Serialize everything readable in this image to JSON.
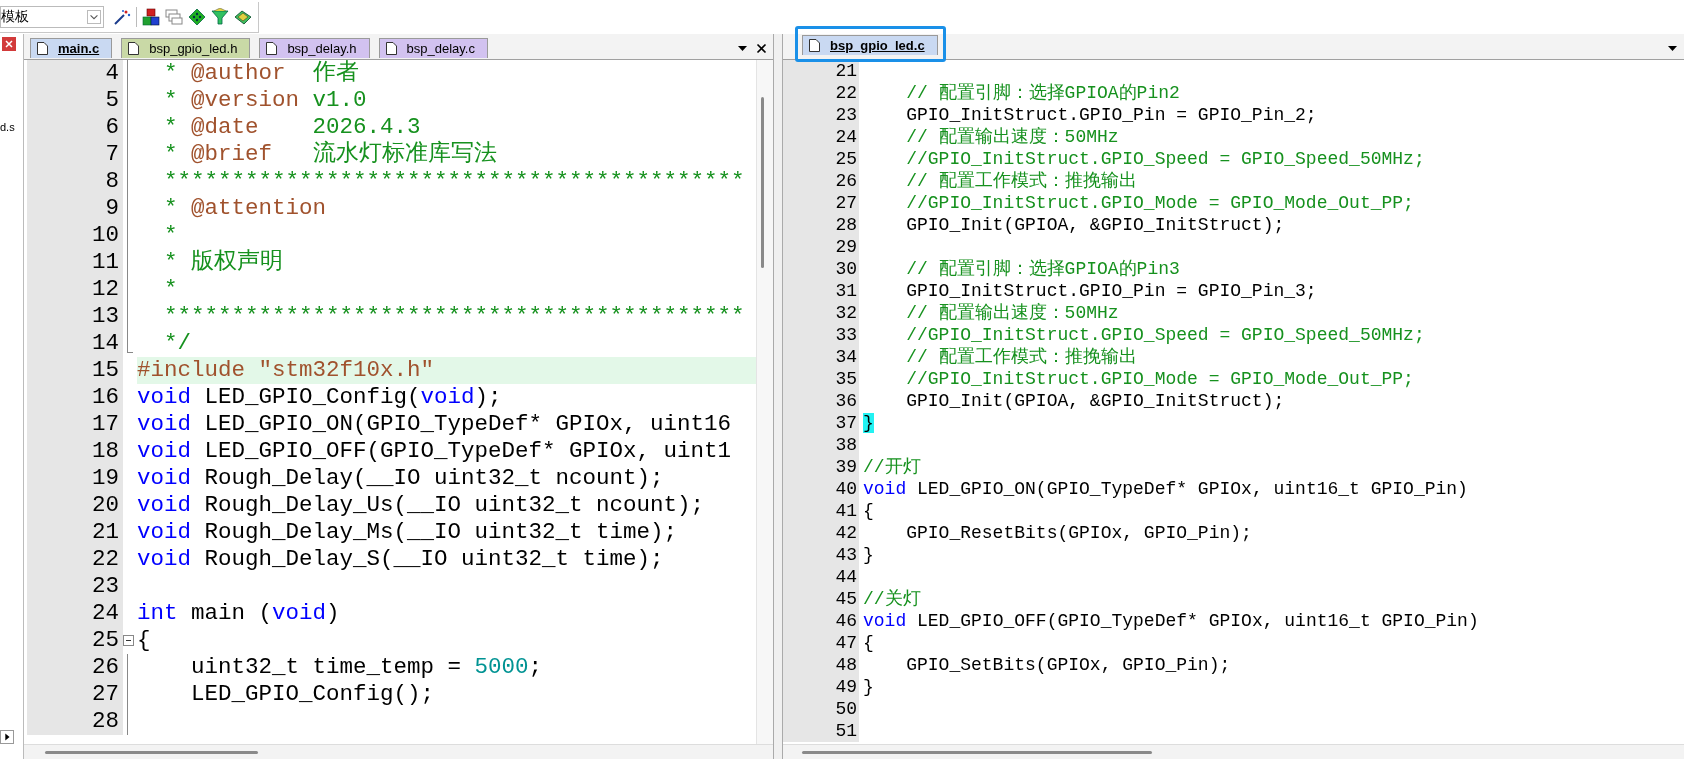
{
  "toolbar": {
    "template_dropdown": {
      "value": "模板"
    }
  },
  "sidebar": {
    "text": "d.s"
  },
  "panes": [
    {
      "tabs": [
        {
          "label": "main.c",
          "selected": true,
          "color": "#c9d9f2",
          "highlighted": false
        },
        {
          "label": "bsp_gpio_led.h",
          "selected": false,
          "color": "#c9d9a6",
          "highlighted": false
        },
        {
          "label": "bsp_delay.h",
          "selected": false,
          "color": "#d2c2f0",
          "highlighted": false
        },
        {
          "label": "bsp_delay.c",
          "selected": false,
          "color": "#d2c2f0",
          "highlighted": false
        }
      ],
      "lines": [
        {
          "number": "4",
          "current": false,
          "fold_line": true,
          "fold_end": false,
          "fold_box": false,
          "segments": [
            {
              "text": "  * ",
              "kind": "comment"
            },
            {
              "text": "@author",
              "kind": "tag"
            },
            {
              "text": "  作者",
              "kind": "comment"
            }
          ]
        },
        {
          "number": "5",
          "current": false,
          "fold_line": true,
          "fold_end": false,
          "fold_box": false,
          "segments": [
            {
              "text": "  * ",
              "kind": "comment"
            },
            {
              "text": "@version",
              "kind": "tag"
            },
            {
              "text": " v1.0",
              "kind": "comment"
            }
          ]
        },
        {
          "number": "6",
          "current": false,
          "fold_line": true,
          "fold_end": false,
          "fold_box": false,
          "segments": [
            {
              "text": "  * ",
              "kind": "comment"
            },
            {
              "text": "@date",
              "kind": "tag"
            },
            {
              "text": "    2026.4.3",
              "kind": "comment"
            }
          ]
        },
        {
          "number": "7",
          "current": false,
          "fold_line": true,
          "fold_end": false,
          "fold_box": false,
          "segments": [
            {
              "text": "  * ",
              "kind": "comment"
            },
            {
              "text": "@brief",
              "kind": "tag"
            },
            {
              "text": "   流水灯标准库写法",
              "kind": "comment"
            }
          ]
        },
        {
          "number": "8",
          "current": false,
          "fold_line": true,
          "fold_end": false,
          "fold_box": false,
          "segments": [
            {
              "text": "  *******************************************",
              "kind": "comment"
            }
          ]
        },
        {
          "number": "9",
          "current": false,
          "fold_line": true,
          "fold_end": false,
          "fold_box": false,
          "segments": [
            {
              "text": "  * ",
              "kind": "comment"
            },
            {
              "text": "@attention",
              "kind": "tag"
            }
          ]
        },
        {
          "number": "10",
          "current": false,
          "fold_line": true,
          "fold_end": false,
          "fold_box": false,
          "segments": [
            {
              "text": "  *",
              "kind": "comment"
            }
          ]
        },
        {
          "number": "11",
          "current": false,
          "fold_line": true,
          "fold_end": false,
          "fold_box": false,
          "segments": [
            {
              "text": "  * 版权声明",
              "kind": "comment"
            }
          ]
        },
        {
          "number": "12",
          "current": false,
          "fold_line": true,
          "fold_end": false,
          "fold_box": false,
          "segments": [
            {
              "text": "  *",
              "kind": "comment"
            }
          ]
        },
        {
          "number": "13",
          "current": false,
          "fold_line": true,
          "fold_end": false,
          "fold_box": false,
          "segments": [
            {
              "text": "  *******************************************",
              "kind": "comment"
            }
          ]
        },
        {
          "number": "14",
          "current": false,
          "fold_line": true,
          "fold_end": true,
          "fold_box": false,
          "segments": [
            {
              "text": "  */",
              "kind": "comment"
            }
          ]
        },
        {
          "number": "15",
          "current": true,
          "fold_line": false,
          "fold_end": false,
          "fold_box": false,
          "segments": [
            {
              "text": "#include \"stm32f10x.h\"",
              "kind": "preproc"
            }
          ]
        },
        {
          "number": "16",
          "current": false,
          "fold_line": false,
          "fold_end": false,
          "fold_box": false,
          "segments": [
            {
              "text": "void",
              "kind": "keyword"
            },
            {
              "text": " LED_GPIO_Config(",
              "kind": "plain"
            },
            {
              "text": "void",
              "kind": "keyword"
            },
            {
              "text": ");",
              "kind": "plain"
            }
          ]
        },
        {
          "number": "17",
          "current": false,
          "fold_line": false,
          "fold_end": false,
          "fold_box": false,
          "segments": [
            {
              "text": "void",
              "kind": "keyword"
            },
            {
              "text": " LED_GPIO_ON(GPIO_TypeDef* GPIOx, uint16",
              "kind": "plain"
            }
          ]
        },
        {
          "number": "18",
          "current": false,
          "fold_line": false,
          "fold_end": false,
          "fold_box": false,
          "segments": [
            {
              "text": "void",
              "kind": "keyword"
            },
            {
              "text": " LED_GPIO_OFF(GPIO_TypeDef* GPIOx, uint1",
              "kind": "plain"
            }
          ]
        },
        {
          "number": "19",
          "current": false,
          "fold_line": false,
          "fold_end": false,
          "fold_box": false,
          "segments": [
            {
              "text": "void",
              "kind": "keyword"
            },
            {
              "text": " Rough_Delay(__IO uint32_t ncount);",
              "kind": "plain"
            }
          ]
        },
        {
          "number": "20",
          "current": false,
          "fold_line": false,
          "fold_end": false,
          "fold_box": false,
          "segments": [
            {
              "text": "void",
              "kind": "keyword"
            },
            {
              "text": " Rough_Delay_Us(__IO uint32_t ncount);",
              "kind": "plain"
            }
          ]
        },
        {
          "number": "21",
          "current": false,
          "fold_line": false,
          "fold_end": false,
          "fold_box": false,
          "segments": [
            {
              "text": "void",
              "kind": "keyword"
            },
            {
              "text": " Rough_Delay_Ms(__IO uint32_t time);",
              "kind": "plain"
            }
          ]
        },
        {
          "number": "22",
          "current": false,
          "fold_line": false,
          "fold_end": false,
          "fold_box": false,
          "segments": [
            {
              "text": "void",
              "kind": "keyword"
            },
            {
              "text": " Rough_Delay_S(__IO uint32_t time);",
              "kind": "plain"
            }
          ]
        },
        {
          "number": "23",
          "current": false,
          "fold_line": false,
          "fold_end": false,
          "fold_box": false
        },
        {
          "number": "24",
          "current": false,
          "fold_line": false,
          "fold_end": false,
          "fold_box": false,
          "segments": [
            {
              "text": "int",
              "kind": "keyword"
            },
            {
              "text": " main (",
              "kind": "plain"
            },
            {
              "text": "void",
              "kind": "keyword"
            },
            {
              "text": ")",
              "kind": "plain"
            }
          ]
        },
        {
          "number": "25",
          "current": false,
          "fold_line": false,
          "fold_end": false,
          "fold_box": true,
          "segments": [
            {
              "text": "{",
              "kind": "plain"
            }
          ]
        },
        {
          "number": "26",
          "current": false,
          "fold_line": true,
          "fold_end": false,
          "fold_box": false,
          "segments": [
            {
              "text": "    uint32_t time_temp = ",
              "kind": "plain"
            },
            {
              "text": "5000",
              "kind": "number"
            },
            {
              "text": ";",
              "kind": "plain"
            }
          ]
        },
        {
          "number": "27",
          "current": false,
          "fold_line": true,
          "fold_end": false,
          "fold_box": false,
          "segments": [
            {
              "text": "    LED_GPIO_Config();",
              "kind": "plain"
            }
          ]
        },
        {
          "number": "28",
          "current": false,
          "fold_line": true,
          "fold_end": false,
          "fold_box": false
        }
      ]
    },
    {
      "tabs": [
        {
          "label": "bsp_gpio_led.c",
          "selected": true,
          "color": "#c9d9f2",
          "highlighted": true
        }
      ],
      "lines": [
        {
          "number": "21",
          "current": false
        },
        {
          "number": "22",
          "current": false,
          "segments": [
            {
              "text": "    // 配置引脚：选择GPIOA的Pin2",
              "kind": "comment"
            }
          ]
        },
        {
          "number": "23",
          "current": false,
          "segments": [
            {
              "text": "    GPIO_InitStruct.GPIO_Pin = GPIO_Pin_2;",
              "kind": "plain"
            }
          ]
        },
        {
          "number": "24",
          "current": false,
          "segments": [
            {
              "text": "    // 配置输出速度：50MHz",
              "kind": "comment"
            }
          ]
        },
        {
          "number": "25",
          "current": false,
          "segments": [
            {
              "text": "    //GPIO_InitStruct.GPIO_Speed = GPIO_Speed_50MHz;",
              "kind": "comment"
            }
          ]
        },
        {
          "number": "26",
          "current": false,
          "segments": [
            {
              "text": "    // 配置工作模式：推挽输出",
              "kind": "comment"
            }
          ]
        },
        {
          "number": "27",
          "current": false,
          "segments": [
            {
              "text": "    //GPIO_InitStruct.GPIO_Mode = GPIO_Mode_Out_PP;",
              "kind": "comment"
            }
          ]
        },
        {
          "number": "28",
          "current": false,
          "segments": [
            {
              "text": "    GPIO_Init(GPIOA, &GPIO_InitStruct);",
              "kind": "plain"
            }
          ]
        },
        {
          "number": "29",
          "current": false
        },
        {
          "number": "30",
          "current": false,
          "segments": [
            {
              "text": "    // 配置引脚：选择GPIOA的Pin3",
              "kind": "comment"
            }
          ]
        },
        {
          "number": "31",
          "current": false,
          "segments": [
            {
              "text": "    GPIO_InitStruct.GPIO_Pin = GPIO_Pin_3;",
              "kind": "plain"
            }
          ]
        },
        {
          "number": "32",
          "current": false,
          "segments": [
            {
              "text": "    // 配置输出速度：50MHz",
              "kind": "comment"
            }
          ]
        },
        {
          "number": "33",
          "current": false,
          "segments": [
            {
              "text": "    //GPIO_InitStruct.GPIO_Speed = GPIO_Speed_50MHz;",
              "kind": "comment"
            }
          ]
        },
        {
          "number": "34",
          "current": false,
          "segments": [
            {
              "text": "    // 配置工作模式：推挽输出",
              "kind": "comment"
            }
          ]
        },
        {
          "number": "35",
          "current": false,
          "segments": [
            {
              "text": "    //GPIO_InitStruct.GPIO_Mode = GPIO_Mode_Out_PP;",
              "kind": "comment"
            }
          ]
        },
        {
          "number": "36",
          "current": false,
          "segments": [
            {
              "text": "    GPIO_Init(GPIOA, &GPIO_InitStruct);",
              "kind": "plain"
            }
          ]
        },
        {
          "number": "37",
          "current": false,
          "segments": [
            {
              "text": "}",
              "kind": "brace-match"
            }
          ]
        },
        {
          "number": "38",
          "current": false
        },
        {
          "number": "39",
          "current": false,
          "segments": [
            {
              "text": "//开灯",
              "kind": "comment"
            }
          ]
        },
        {
          "number": "40",
          "current": false,
          "segments": [
            {
              "text": "void",
              "kind": "keyword"
            },
            {
              "text": " LED_GPIO_ON(GPIO_TypeDef* GPIOx, uint16_t GPIO_Pin)",
              "kind": "plain"
            }
          ]
        },
        {
          "number": "41",
          "current": false,
          "segments": [
            {
              "text": "{",
              "kind": "plain"
            }
          ]
        },
        {
          "number": "42",
          "current": false,
          "segments": [
            {
              "text": "    GPIO_ResetBits(GPIOx, GPIO_Pin);",
              "kind": "plain"
            }
          ]
        },
        {
          "number": "43",
          "current": false,
          "segments": [
            {
              "text": "}",
              "kind": "plain"
            }
          ]
        },
        {
          "number": "44",
          "current": false
        },
        {
          "number": "45",
          "current": false,
          "segments": [
            {
              "text": "//关灯",
              "kind": "comment"
            }
          ]
        },
        {
          "number": "46",
          "current": false,
          "segments": [
            {
              "text": "void",
              "kind": "keyword"
            },
            {
              "text": " LED_GPIO_OFF(GPIO_TypeDef* GPIOx, uint16_t GPIO_Pin)",
              "kind": "plain"
            }
          ]
        },
        {
          "number": "47",
          "current": false,
          "segments": [
            {
              "text": "{",
              "kind": "plain"
            }
          ]
        },
        {
          "number": "48",
          "current": false,
          "segments": [
            {
              "text": "    GPIO_SetBits(GPIOx, GPIO_Pin);",
              "kind": "plain"
            }
          ]
        },
        {
          "number": "49",
          "current": false,
          "segments": [
            {
              "text": "}",
              "kind": "plain"
            }
          ]
        },
        {
          "number": "50",
          "current": false
        },
        {
          "number": "51",
          "current": false
        }
      ]
    }
  ]
}
